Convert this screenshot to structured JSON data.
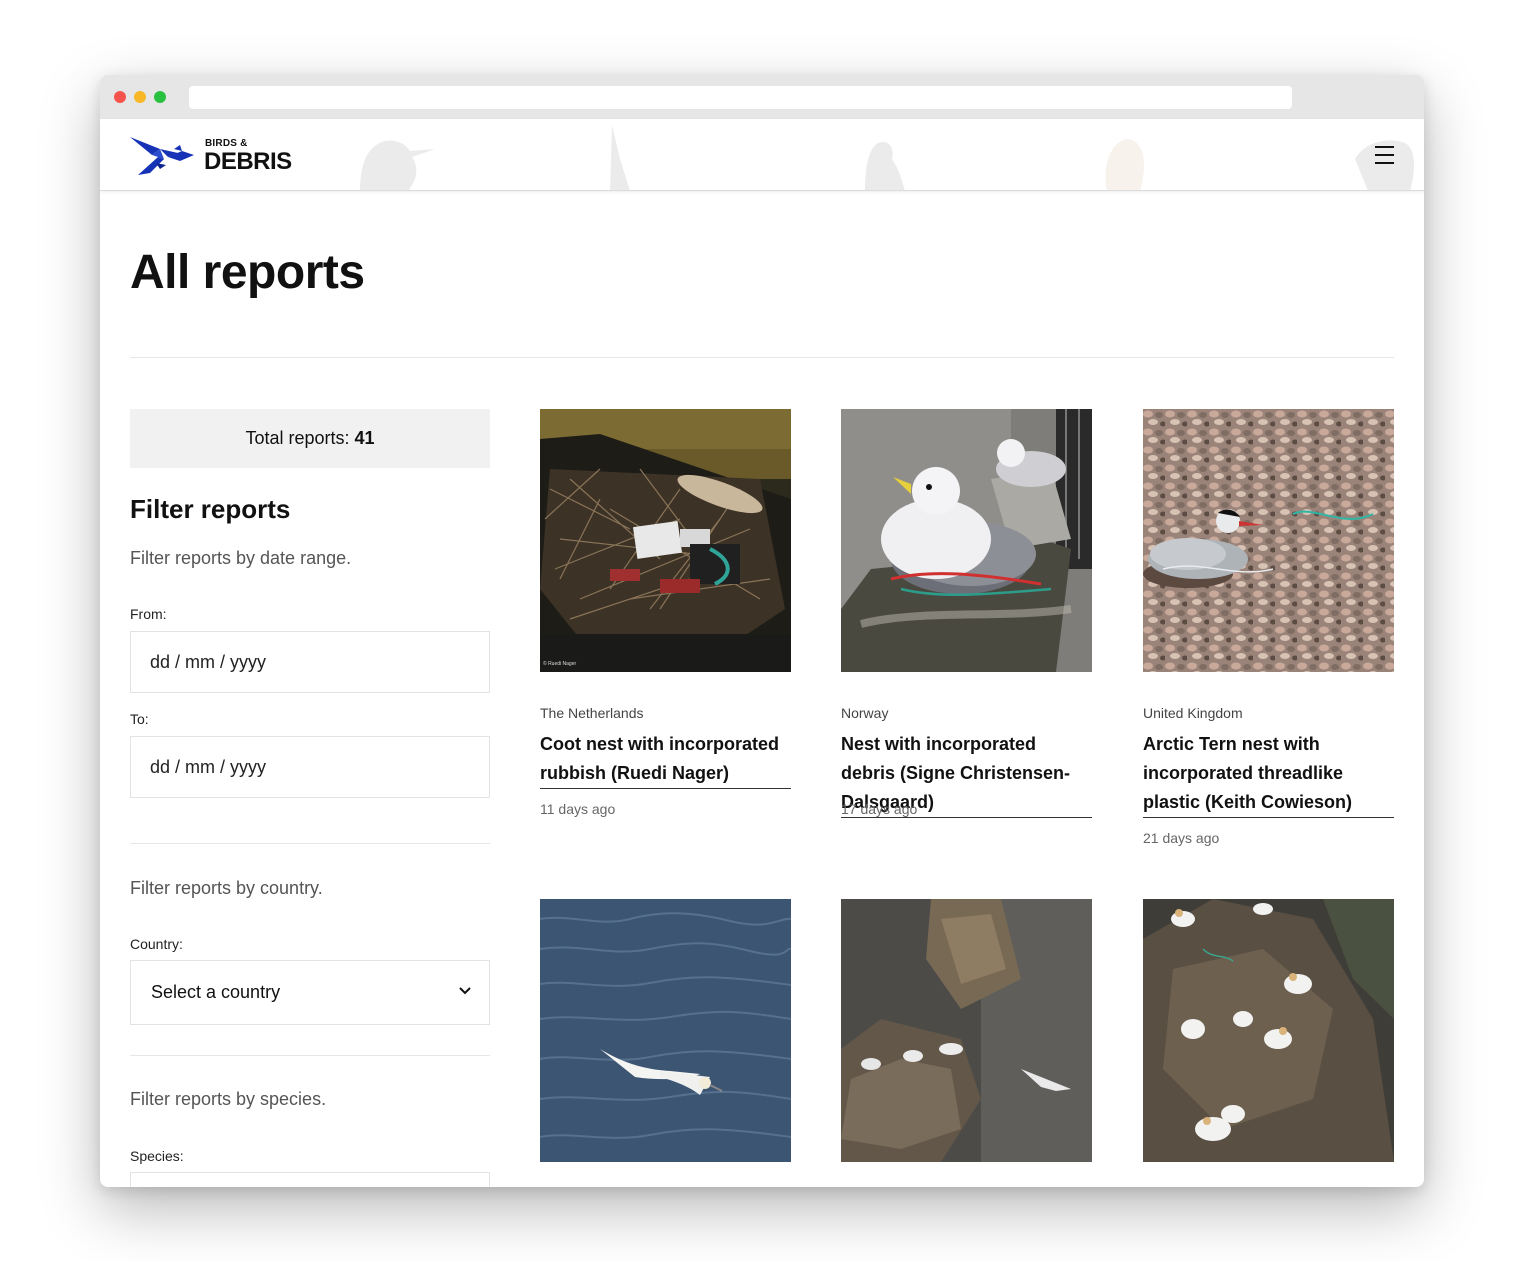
{
  "site": {
    "logo_small": "BIRDS &",
    "logo_big": "DEBRIS",
    "brand_color": "#1633b8"
  },
  "page": {
    "title": "All reports"
  },
  "sidebar": {
    "total_label": "Total reports: ",
    "total_value": "41",
    "filter_title": "Filter reports",
    "date_desc": "Filter reports by date range.",
    "from_label": "From:",
    "from_placeholder": "dd / mm / yyyy",
    "to_label": "To:",
    "to_placeholder": "dd / mm / yyyy",
    "country_desc": "Filter reports by country.",
    "country_label": "Country:",
    "country_selected": "Select a country",
    "species_desc": "Filter reports by species.",
    "species_label": "Species:"
  },
  "reports": [
    {
      "country": "The Netherlands",
      "title": "Coot nest with incorporated rubbish (Ruedi Nager)",
      "ago": "11 days ago",
      "photo_credit": "© Ruedi Nager"
    },
    {
      "country": "Norway",
      "title": "Nest with incorporated debris (Signe Christensen-Dalsgaard)",
      "ago": "17 days ago"
    },
    {
      "country": "United Kingdom",
      "title": "Arctic Tern nest with incorporated threadlike plastic (Keith Cowieson)",
      "ago": "21 days ago"
    },
    {
      "country": "",
      "title": "",
      "ago": ""
    },
    {
      "country": "",
      "title": "",
      "ago": ""
    },
    {
      "country": "",
      "title": "",
      "ago": ""
    }
  ]
}
